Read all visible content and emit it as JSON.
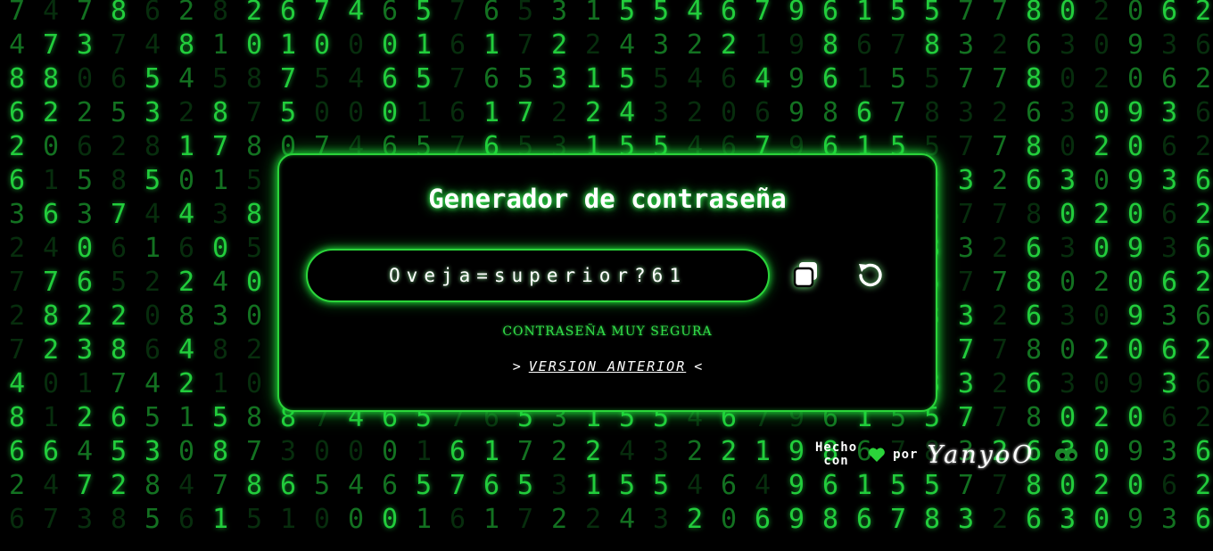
{
  "background": {
    "theme": "matrix-digit-rain",
    "color": "#000000",
    "digit_color": "#22c33a",
    "columns": [
      "7486263272",
      "6478201",
      "24730265306231",
      "65287",
      "4120645385",
      "21046284",
      "7130438158",
      "7858500208",
      "3617508",
      "0705",
      "40",
      "06",
      "51",
      "67",
      "61",
      "75",
      "32",
      "21",
      "54",
      "35",
      "42",
      "0626",
      "4671",
      "9",
      "68",
      "61",
      "57",
      "85",
      "73",
      "27",
      "86",
      "30",
      "20",
      "90",
      "63",
      "62"
    ]
  },
  "card": {
    "title": "Generador de contraseña",
    "password": "Oveja=superior?61",
    "copy_icon": "copy-icon",
    "refresh_icon": "refresh-icon",
    "strength_label": "CONTRASEÑA MUY SEGURA",
    "prev_prefix": ">",
    "prev_link": "VERSION ANTERIOR",
    "prev_suffix": "<",
    "accent": "#2bd43a"
  },
  "footer": {
    "hecho": "Hecho",
    "con": "con",
    "heart_icon": "heart-icon",
    "por": "por",
    "author": "YanyoO",
    "eyes_icon": "eyes-icon",
    "heart_color": "#2bd43a"
  }
}
